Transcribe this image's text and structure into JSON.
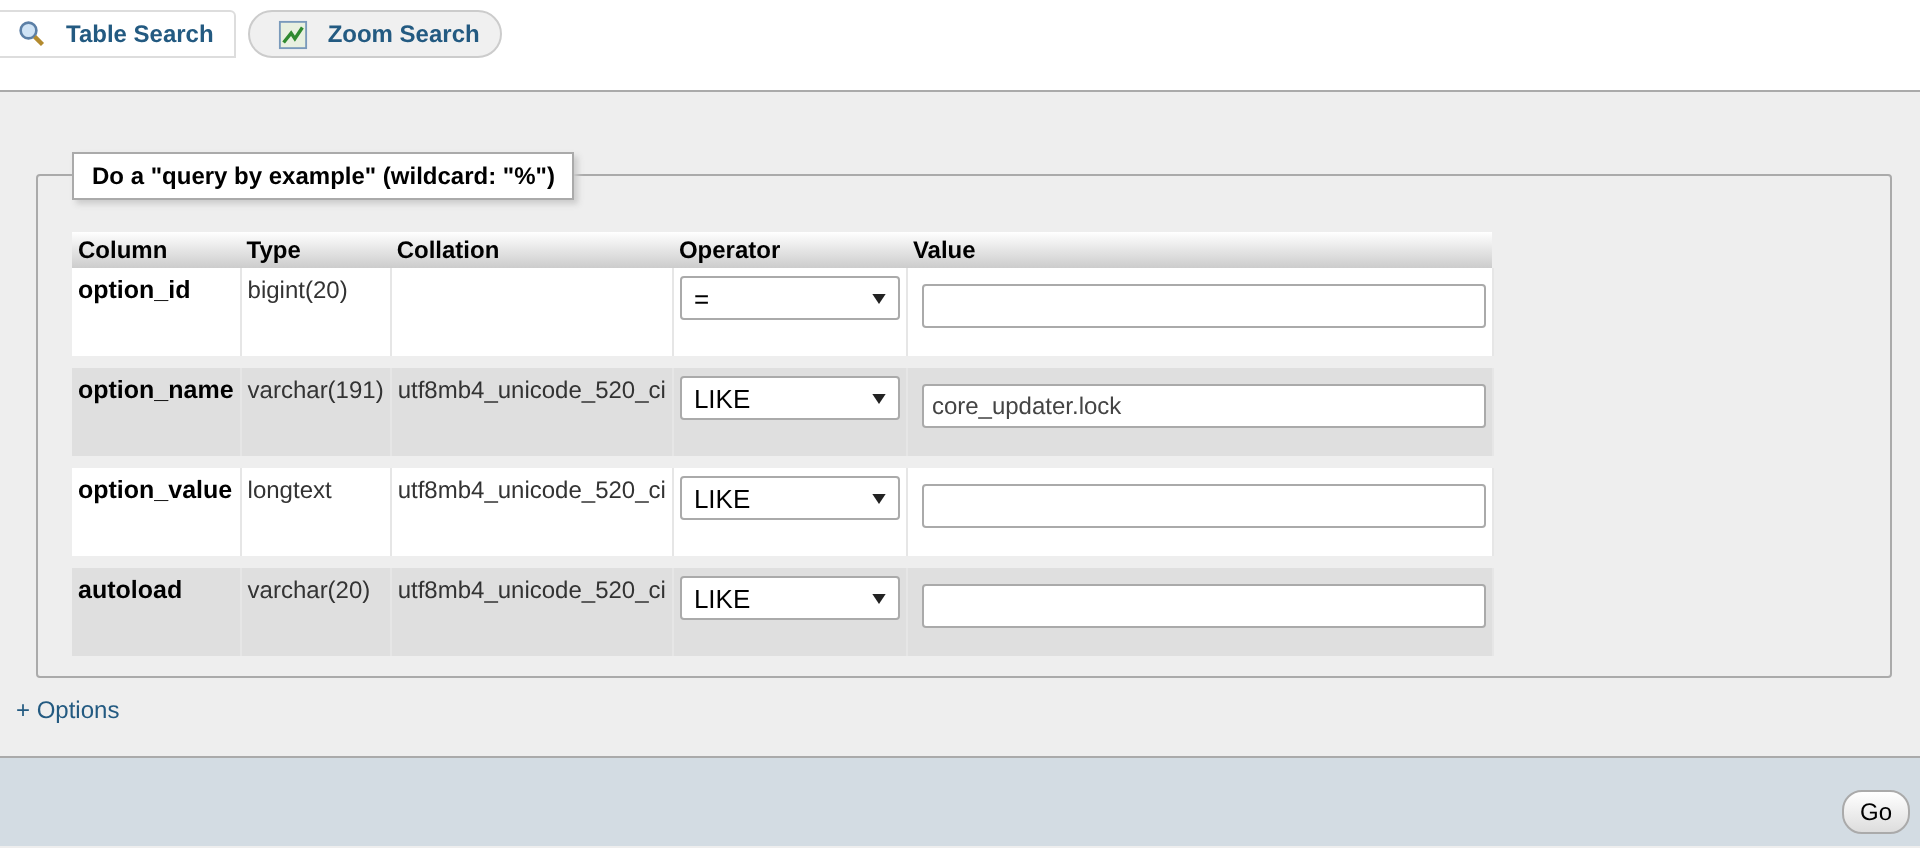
{
  "tabs": [
    {
      "label": "Table Search",
      "kind": "search",
      "selected": true
    },
    {
      "label": "Zoom Search",
      "kind": "chart",
      "selected": false
    }
  ],
  "fieldset": {
    "legend": "Do a \"query by example\" (wildcard: \"%\")",
    "columns": [
      "Column",
      "Type",
      "Collation",
      "Operator",
      "Value"
    ],
    "rows": [
      {
        "column": "option_id",
        "type": "bigint(20)",
        "operator": "="
      },
      {
        "column": "option_name",
        "type": "varchar(191)",
        "collation": "utf8mb4_unicode_520_ci",
        "operator": "LIKE",
        "value": "core_updater.lock"
      },
      {
        "column": "option_value",
        "type": "longtext",
        "collation": "utf8mb4_unicode_520_ci",
        "operator": "LIKE"
      },
      {
        "column": "autoload",
        "type": "varchar(20)",
        "collation": "utf8mb4_unicode_520_ci",
        "operator": "LIKE"
      }
    ]
  },
  "options_link": "+ Options",
  "footer": {
    "button": "Go"
  }
}
